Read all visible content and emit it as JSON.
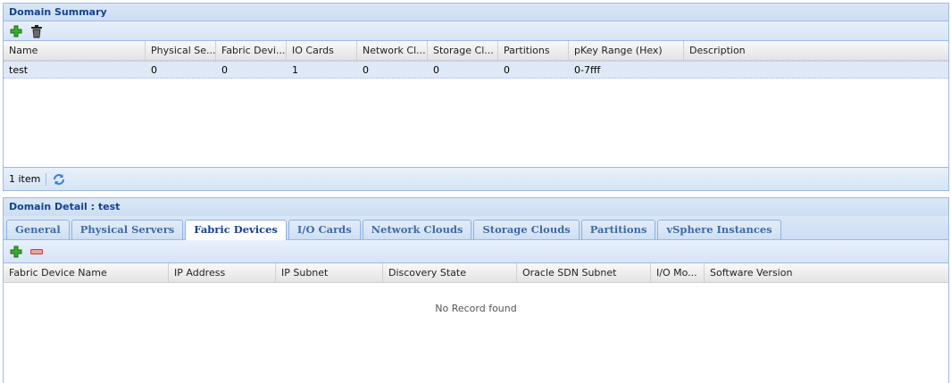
{
  "summary": {
    "title": "Domain Summary",
    "toolbar": {
      "add_icon": "add-icon",
      "delete_icon": "trash-icon"
    },
    "columns": [
      "Name",
      "Physical Se...",
      "Fabric Devi...",
      "IO Cards",
      "Network Cl...",
      "Storage Cl...",
      "Partitions",
      "pKey Range (Hex)",
      "Description"
    ],
    "rows": [
      [
        "test",
        "0",
        "0",
        "1",
        "0",
        "0",
        "0",
        "0-7fff",
        ""
      ]
    ],
    "paging": {
      "count_text": "1 item",
      "refresh_icon": "refresh-icon"
    }
  },
  "detail": {
    "title": "Domain Detail : test",
    "tabs": [
      "General",
      "Physical Servers",
      "Fabric Devices",
      "I/O Cards",
      "Network Clouds",
      "Storage Clouds",
      "Partitions",
      "vSphere Instances"
    ],
    "active_tab": "Fabric Devices",
    "toolbar": {
      "add_icon": "add-icon",
      "remove_icon": "remove-icon"
    },
    "columns": [
      "Fabric Device Name",
      "IP Address",
      "IP Subnet",
      "Discovery State",
      "Oracle SDN Subnet",
      "I/O Mo...",
      "Software Version"
    ],
    "empty_text": "No Record found"
  },
  "colors": {
    "header_text": "#15428b",
    "border": "#99bbe8",
    "selected_row": "#dfe8f6"
  }
}
